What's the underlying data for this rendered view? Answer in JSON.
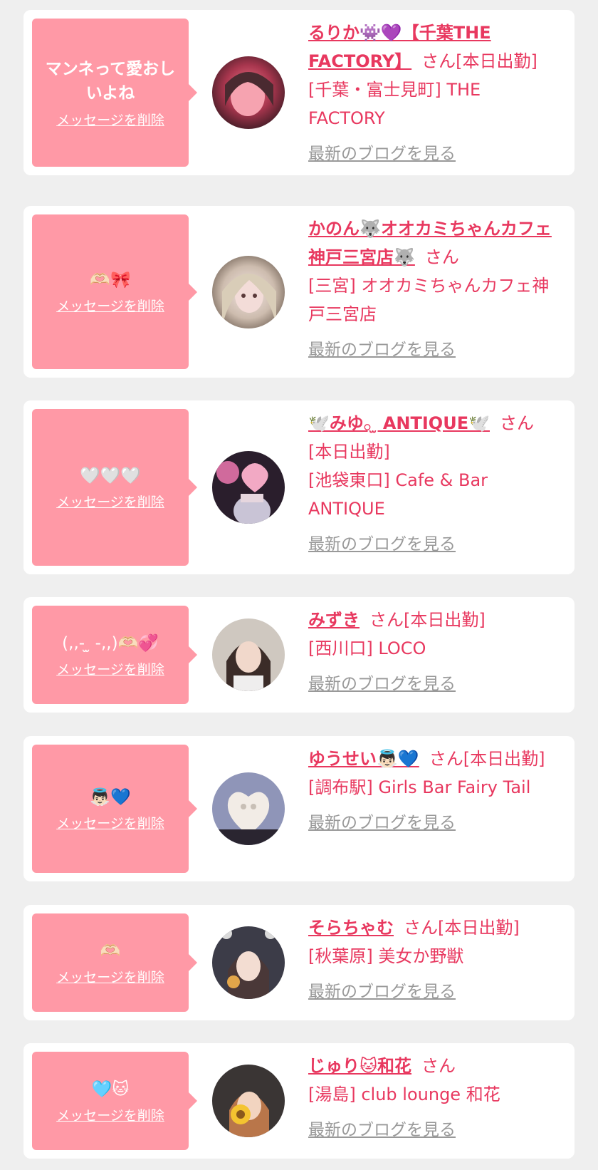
{
  "delete_label": "メッセージを削除",
  "san_label": "さん",
  "blog_label": "最新のブログを見る",
  "colors": {
    "background": "#efefef",
    "card": "#ffffff",
    "bubble": "#ff99a6",
    "accent": "#e8385f",
    "muted": "#999999"
  },
  "items": [
    {
      "message": "マンネって愛おしいよね",
      "name": "るりか👾💜【千葉THE FACTORY】",
      "status": "[本日出勤]",
      "shop": "[千葉・富士見町] THE FACTORY"
    },
    {
      "message": "🫶🏻🎀",
      "name": "かのん🐺オオカミちゃんカフェ神戸三宮店🐺",
      "status": "",
      "shop": "[三宮] オオカミちゃんカフェ神戸三宮店"
    },
    {
      "message": "🤍🤍🤍",
      "name": "🕊️みゆ𓂂 ̫ ANTIQUE🕊️",
      "status": "[本日出勤]",
      "shop": "[池袋東口] Cafe & Bar ANTIQUE"
    },
    {
      "message": "(,,- ̫ -,,)🫶🏻💞",
      "name": "みずき",
      "status": "[本日出勤]",
      "shop": "[西川口] LOCO"
    },
    {
      "message": "👼🏻💙",
      "name": "ゆうせい👼🏻💙",
      "status": "[本日出勤]",
      "shop": "[調布駅] Girls Bar Fairy Tail"
    },
    {
      "message": "🫶🏻",
      "name": "そらちゃむ",
      "status": "[本日出勤]",
      "shop": "[秋葉原] 美女か野獣"
    },
    {
      "message": "🩵🐱",
      "name": "じゅり🐱和花",
      "status": "",
      "shop": "[湯島] club lounge 和花"
    }
  ]
}
